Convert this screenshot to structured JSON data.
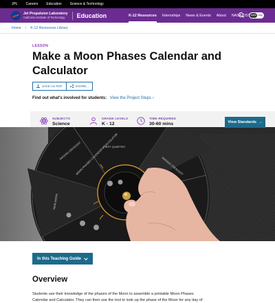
{
  "utility_bar": {
    "items": [
      "JPL",
      "Careers",
      "Education",
      "Science & Technology"
    ]
  },
  "nav": {
    "org_line1": "Jet Propulsion Laboratory",
    "org_line2": "California Institute of Technology",
    "section_title": "Education",
    "links": [
      "K-12 Resources",
      "Internships",
      "News & Events",
      "About",
      "NASA OSTEM"
    ],
    "active_link": "K-12 Resources",
    "theme_toggle": {
      "on": "Dark",
      "off": "Day"
    },
    "colors": {
      "nav_bg": "#6b2c91",
      "utility_bg": "#000000"
    }
  },
  "breadcrumb": {
    "items": [
      "Home",
      "K-12 Resources Library"
    ]
  },
  "header": {
    "eyebrow": "LESSON",
    "title": "Make a Moon Phases Calendar and Calculator",
    "save_pdf": "SAVE AS PDF",
    "share": "SHARE...",
    "involved_prefix": "Find out what's involved for students:",
    "involved_link": "View the Project Steps"
  },
  "stats": {
    "subjects_label": "SUBJECTS",
    "subjects_value": "Science",
    "grade_label": "GRADE LEVELS",
    "grade_value": "K - 12",
    "time_label": "TIME REQUIRED",
    "time_value": "30-60 mins",
    "button": "View Standards"
  },
  "hero": {
    "wheel_labels": [
      "WAXING CRESCENT",
      "FIRST QUARTER",
      "WANING CRESCENT",
      "NEW MOON",
      "MOON PHASES CALENDAR & CALCULATOR"
    ],
    "icon": "moon-phases-calculator-photo"
  },
  "guide_button": "In this Teaching Guide",
  "overview": {
    "heading": "Overview",
    "text": "Students use their knowledge of the phases of the Moon to assemble a printable Moon Phases Calendar and Calculator. They can then use the tool to look up the phase of the Moon for any day of"
  },
  "accent": {
    "link": "#1f6fa8",
    "purple": "#8a3fb5",
    "teal_button": "#1d6a8c"
  }
}
